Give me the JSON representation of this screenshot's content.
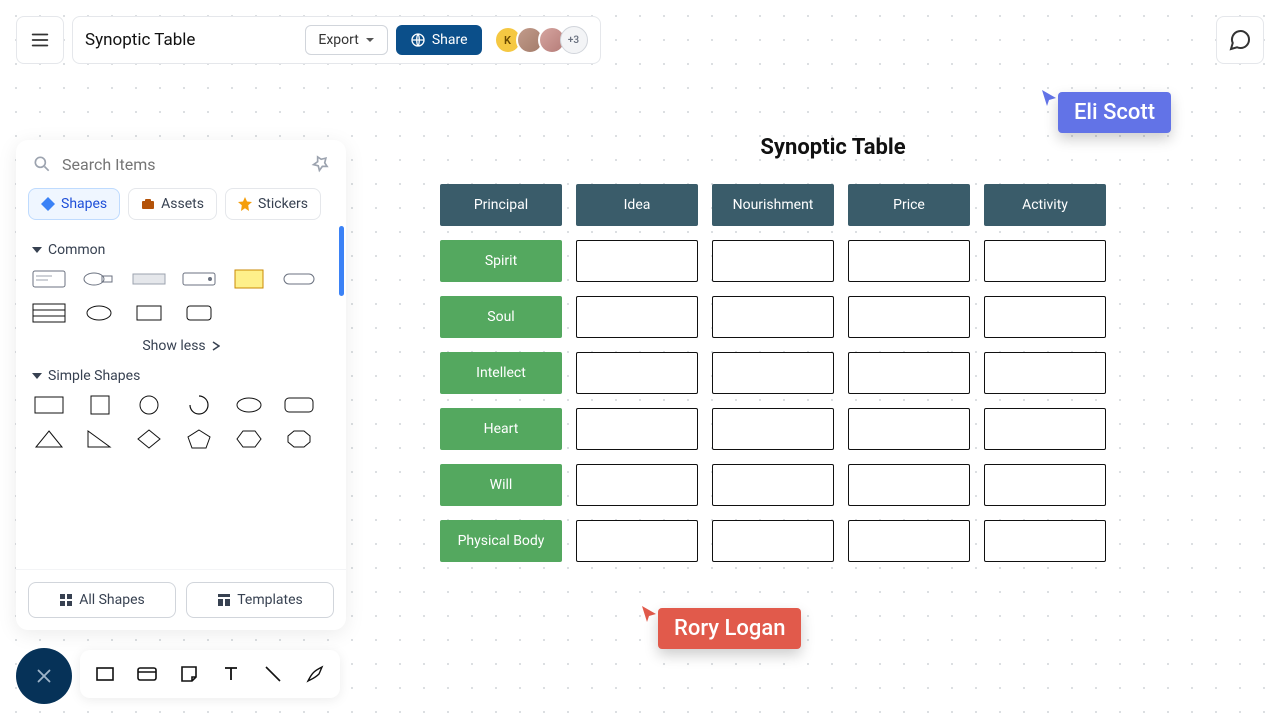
{
  "header": {
    "doc_title": "Synoptic Table",
    "export": "Export",
    "share": "Share",
    "avatar_initial": "K",
    "more_avatars": "+3"
  },
  "panel": {
    "search_placeholder": "Search Items",
    "tabs": {
      "shapes": "Shapes",
      "assets": "Assets",
      "stickers": "Stickers"
    },
    "sections": {
      "common": "Common",
      "simple": "Simple Shapes"
    },
    "show_less": "Show less",
    "footer": {
      "all_shapes": "All Shapes",
      "templates": "Templates"
    }
  },
  "canvas": {
    "title": "Synoptic Table",
    "columns": [
      "Principal",
      "Idea",
      "Nourishment",
      "Price",
      "Activity"
    ],
    "rows": [
      "Spirit",
      "Soul",
      "Intellect",
      "Heart",
      "Will",
      "Physical Body"
    ]
  },
  "cursors": {
    "eli": "Eli Scott",
    "rory": "Rory Logan"
  }
}
